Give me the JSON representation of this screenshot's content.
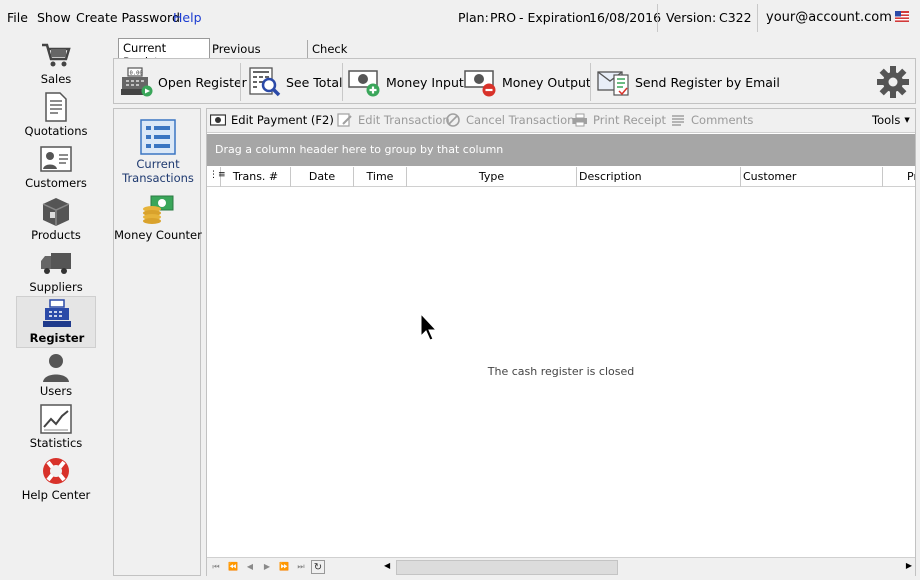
{
  "menu": {
    "file": "File",
    "show": "Show",
    "create_password": "Create Password",
    "help": "Help"
  },
  "status": {
    "plan_label": "Plan:",
    "plan_value": "PRO",
    "expiration_label": "- Expiration",
    "expiration_value": "16/08/2016",
    "version_label": "Version:",
    "version_value": "C322",
    "account": "your@account.com"
  },
  "sidebar": {
    "items": [
      {
        "label": "Sales",
        "icon": "cart-icon"
      },
      {
        "label": "Quotations",
        "icon": "document-icon"
      },
      {
        "label": "Customers",
        "icon": "contact-card-icon"
      },
      {
        "label": "Products",
        "icon": "box-icon"
      },
      {
        "label": "Suppliers",
        "icon": "truck-icon"
      },
      {
        "label": "Register",
        "icon": "cash-register-icon",
        "active": true
      },
      {
        "label": "Users",
        "icon": "user-icon"
      },
      {
        "label": "Statistics",
        "icon": "line-chart-icon"
      },
      {
        "label": "Help Center",
        "icon": "lifebuoy-icon"
      }
    ]
  },
  "tabs": {
    "current_register": "Current Register",
    "previous_registers": "Previous Registers",
    "check_payment_method": "Check Payment Method"
  },
  "toolbar": {
    "open_register": "Open Register",
    "register_display": "0.00",
    "see_total": "See Total",
    "money_input": "Money Input",
    "money_output": "Money Output",
    "send_register_email": "Send Register by Email"
  },
  "left_panel": {
    "current_transactions_1": "Current",
    "current_transactions_2": "Transactions",
    "money_counter": "Money Counter"
  },
  "grid": {
    "toolbar": {
      "edit_payment": "Edit Payment (F2)",
      "edit_transaction": "Edit Transaction",
      "cancel_transaction": "Cancel Transaction",
      "print_receipt": "Print Receipt",
      "comments": "Comments",
      "tools": "Tools"
    },
    "group_hint": "Drag a column header here to group by that column",
    "columns": [
      "Trans. #",
      "Date",
      "Time",
      "Type",
      "Description",
      "Customer",
      "Pr"
    ],
    "empty_message": "The cash register is closed"
  },
  "colors": {
    "help_link": "#1a3bd1",
    "group_area": "#a6a6a6",
    "accent_green": "#3aa65a",
    "accent_red": "#d8322a"
  }
}
